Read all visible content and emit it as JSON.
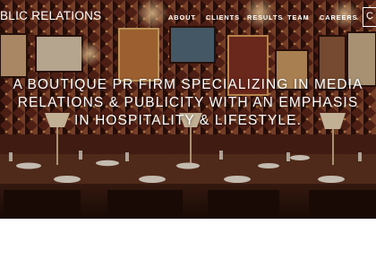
{
  "header": {
    "brand_visible": "BLIC RELATIONS",
    "nav": [
      {
        "label": "ABOUT"
      },
      {
        "label": "CLIENTS"
      },
      {
        "label": "RESULTS"
      },
      {
        "label": "TEAM"
      },
      {
        "label": "CAREERS"
      }
    ],
    "contact_glyph": "C"
  },
  "hero": {
    "tagline_lines": [
      "A BOUTIQUE PR FIRM SPECIALIZING IN MEDIA",
      "RELATIONS & PUBLICITY WITH AN EMPHASIS",
      "IN HOSPITALITY & LIFESTYLE."
    ]
  },
  "colors": {
    "wall": "#6b2a1a",
    "table": "#3a1f14",
    "text": "#ffffff"
  }
}
